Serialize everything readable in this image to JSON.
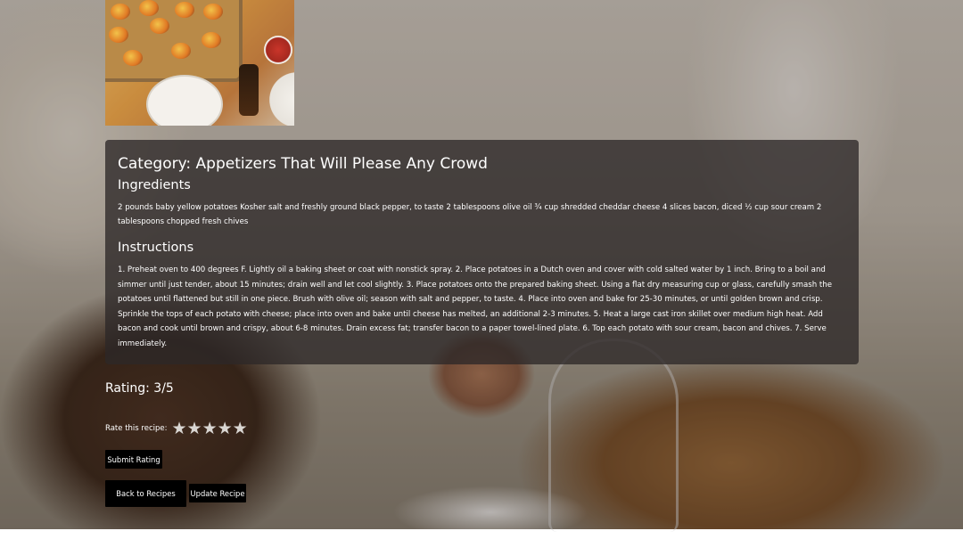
{
  "recipe": {
    "category": "Category: Appetizers That Will Please Any Crowd",
    "ingredients_heading": "Ingredients",
    "ingredients": "2 pounds baby yellow potatoes Kosher salt and freshly ground black pepper, to taste 2 tablespoons olive oil ¾ cup shredded cheddar cheese 4 slices bacon, diced ½ cup sour cream 2 tablespoons chopped fresh chives",
    "instructions_heading": "Instructions",
    "instructions": "1. Preheat oven to 400 degrees F. Lightly oil a baking sheet or coat with nonstick spray. 2. Place potatoes in a Dutch oven and cover with cold salted water by 1 inch. Bring to a boil and simmer until just tender, about 15 minutes; drain well and let cool slightly. 3. Place potatoes onto the prepared baking sheet. Using a flat dry measuring cup or glass, carefully smash the potatoes until flattened but still in one piece. Brush with olive oil; season with salt and pepper, to taste. 4. Place into oven and bake for 25-30 minutes, or until golden brown and crisp. Sprinkle the tops of each potato with cheese; place into oven and bake until cheese has melted, an additional 2-3 minutes. 5. Heat a large cast iron skillet over medium high heat. Add bacon and cook until brown and crispy, about 6-8 minutes. Drain excess fat; transfer bacon to a paper towel-lined plate. 6. Top each potato with sour cream, bacon and chives. 7. Serve immediately."
  },
  "rating": {
    "text": "Rating: 3/5",
    "rate_label": "Rate this recipe:",
    "stars": [
      "★",
      "★",
      "★",
      "★",
      "★"
    ]
  },
  "buttons": {
    "submit_rating": "Submit Rating",
    "back_to_recipes": "Back to Recipes",
    "update_recipe": "Update Recipe"
  }
}
